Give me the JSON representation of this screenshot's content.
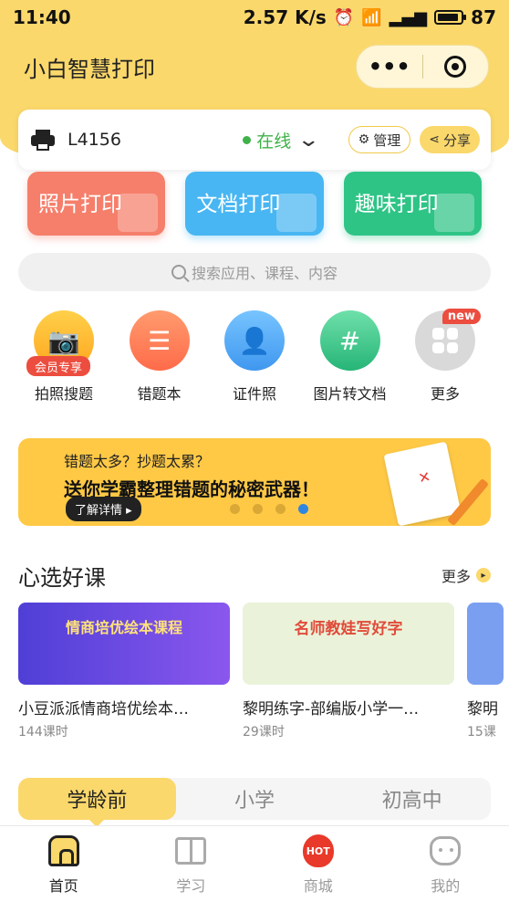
{
  "status_bar": {
    "time": "11:40",
    "speed": "2.57 K/s",
    "network": "4G",
    "battery": "87"
  },
  "header": {
    "title": "小白智慧打印",
    "menu_dots": "•••"
  },
  "printer": {
    "name": "L4156",
    "status": "在线",
    "manage_label": "管理",
    "share_label": "分享"
  },
  "print_tiles": [
    {
      "label": "照片打印"
    },
    {
      "label": "文档打印"
    },
    {
      "label": "趣味打印"
    }
  ],
  "search": {
    "placeholder": "搜索应用、课程、内容"
  },
  "functions": [
    {
      "label": "拍照搜题",
      "badge": "会员专享",
      "icon": "camera-icon"
    },
    {
      "label": "错题本",
      "icon": "notebook-icon"
    },
    {
      "label": "证件照",
      "icon": "id-photo-icon"
    },
    {
      "label": "图片转文档",
      "icon": "image-to-doc-icon"
    },
    {
      "label": "更多",
      "badge": "new",
      "icon": "grid-icon"
    }
  ],
  "banner": {
    "line1": "错题太多？抄题太累？",
    "line2": "送你学霸整理错题的秘密武器！",
    "button": "了解详情 ▸",
    "active_dot": 4,
    "dot_count": 4
  },
  "courses_section": {
    "title": "心选好课",
    "more": "更多",
    "courses": [
      {
        "thumb_text": "情商培优绘本课程",
        "title": "小豆派派情商培优绘本…",
        "lessons": "144课时"
      },
      {
        "thumb_text": "名师教娃写好字",
        "title": "黎明练字-部编版小学一…",
        "lessons": "29课时"
      },
      {
        "thumb_text": "",
        "title": "黎明",
        "lessons": "15课"
      }
    ]
  },
  "age_tabs": [
    {
      "label": "学龄前",
      "active": true
    },
    {
      "label": "小学",
      "active": false
    },
    {
      "label": "初高中",
      "active": false
    }
  ],
  "bottom_nav": [
    {
      "label": "首页",
      "icon": "home-icon",
      "active": true
    },
    {
      "label": "学习",
      "icon": "book-icon",
      "active": false
    },
    {
      "label": "商城",
      "icon": "hot-icon",
      "active": false,
      "badge": "HOT"
    },
    {
      "label": "我的",
      "icon": "profile-dog-icon",
      "active": false
    }
  ],
  "colors": {
    "brand_yellow": "#fbd86b",
    "online_green": "#3fb249",
    "photo_tile": "#f57f6b",
    "doc_tile": "#48b6f2",
    "fun_tile": "#2ec486"
  }
}
